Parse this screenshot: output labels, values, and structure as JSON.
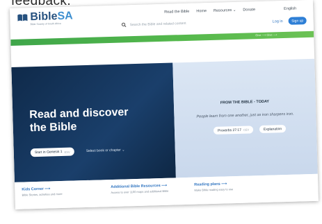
{
  "caption": "feedback.",
  "logo": {
    "brand_main": "Bible",
    "brand_accent": "SA",
    "tagline": "Bible Society of South Africa"
  },
  "nav": {
    "items": [
      "Read the Bible",
      "Home",
      "Resources ⌄",
      "Donate"
    ],
    "language": "English"
  },
  "search": {
    "placeholder": "Search the Bible and related content"
  },
  "auth": {
    "login": "Log in",
    "signup": "Sign up"
  },
  "greenbar": {
    "text": "Give ⟶  Give ⟶"
  },
  "hero": {
    "title_line1": "Read and discover",
    "title_line2": "the Bible",
    "start_button": "Start in Genesis 1",
    "start_tag": "ESV",
    "select_link": "Select book or chapter ⌄"
  },
  "verse": {
    "heading": "FROM THE BIBLE - TODAY",
    "text": "People learn from one another, just as iron sharpens iron.",
    "reference": "Proverbs 27:17",
    "reference_tag": "CEV",
    "explanation_button": "Explanation"
  },
  "cards": [
    {
      "title": "Kids Corner ⟶",
      "desc": "Bible Stories, activities and more"
    },
    {
      "title": "Additional Bible Resources ⟶",
      "desc": "Access to over 1100 maps and additional Bible"
    },
    {
      "title": "Reading plans ⟶",
      "desc": "Make Bible reading easy to use"
    }
  ],
  "colors": {
    "brand_blue": "#26517f",
    "accent_blue": "#2e7fd6",
    "green_bar": "#4caf50",
    "hero_dark": "#13345a",
    "hero_light": "#d6e2f1"
  }
}
